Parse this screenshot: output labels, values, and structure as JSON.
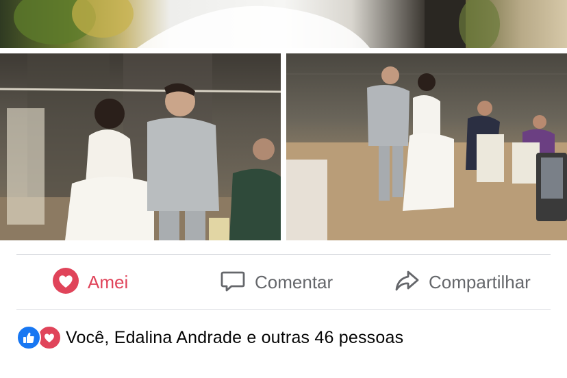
{
  "actions": {
    "love_label": "Amei",
    "comment_label": "Comentar",
    "share_label": "Compartilhar"
  },
  "reactions": {
    "summary": "Você, Edalina Andrade e outras 46 pessoas",
    "icons": [
      "like-icon",
      "love-icon"
    ]
  },
  "colors": {
    "love": "#e0445a",
    "like": "#1877f2",
    "muted_text": "#65676b"
  }
}
